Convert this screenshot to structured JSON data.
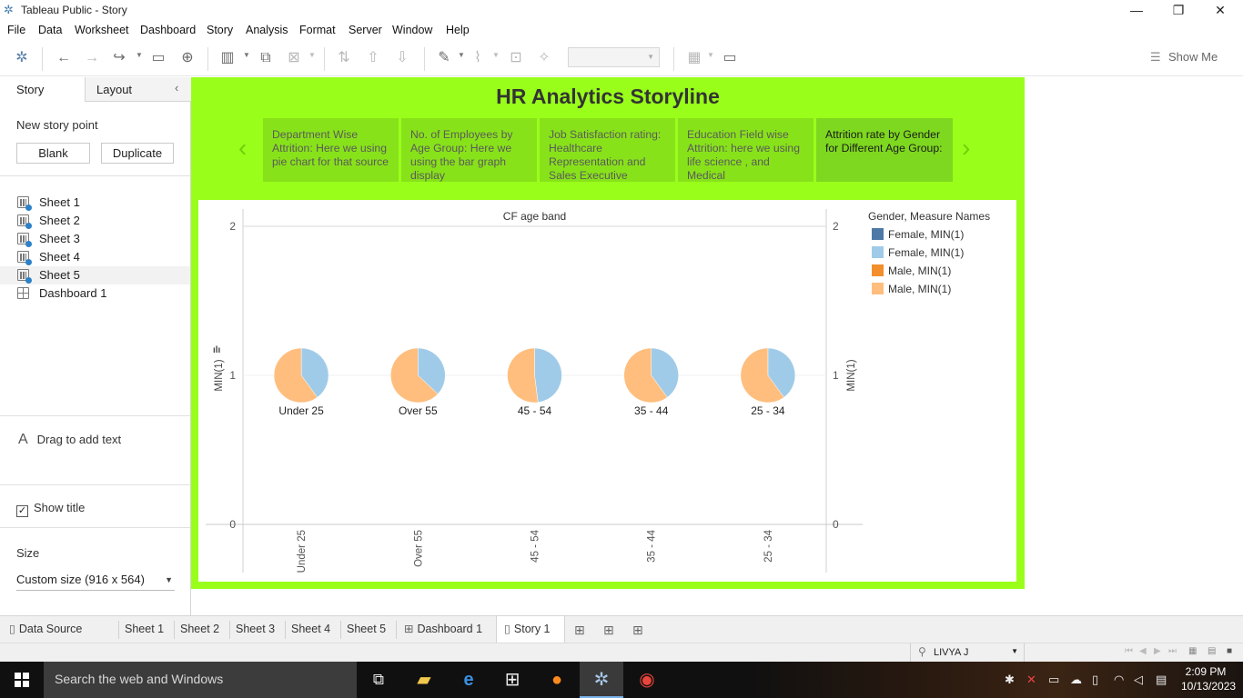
{
  "window": {
    "title": "Tableau Public - Story",
    "minimize": "—",
    "restore": "❐",
    "close": "✕"
  },
  "menu": [
    "File",
    "Data",
    "Worksheet",
    "Dashboard",
    "Story",
    "Analysis",
    "Format",
    "Server",
    "Window",
    "Help"
  ],
  "toolbar": {
    "show_me": "Show Me",
    "icons": [
      "tableau-logo-icon",
      "undo-icon",
      "redo-icon",
      "replay-icon",
      "save-icon",
      "new-data-source-icon",
      "new-worksheet-icon",
      "duplicate-sheet-icon",
      "clear-sheet-icon",
      "swap-icon",
      "sort-ascending-icon",
      "sort-descending-icon",
      "highlight-icon",
      "group-icon",
      "label-icon",
      "fix-axes-icon",
      "fit-icon",
      "presentation-icon"
    ]
  },
  "left_pane": {
    "tabs": [
      "Story",
      "Layout"
    ],
    "collapse": "‹",
    "new_story_point": "New story point",
    "blank_button": "Blank",
    "duplicate_button": "Duplicate",
    "sheets": [
      "Sheet 1",
      "Sheet 2",
      "Sheet 3",
      "Sheet 4",
      "Sheet 5",
      "Dashboard 1"
    ],
    "drag_to_add_text": "Drag to add text",
    "drag_icon": "A",
    "show_title": "Show title",
    "show_title_checked": "✓",
    "size_label": "Size",
    "size_value": "Custom size (916 x 564)"
  },
  "story": {
    "title": "HR Analytics Storyline",
    "background": "#99ff1a",
    "prev_arrow": "‹",
    "next_arrow": "›",
    "points": [
      "Department Wise Attrition: Here we using pie chart for that source",
      "No. of Employees by Age Group: Here we using the bar graph display",
      "Job Satisfaction rating: Healthcare Representation and Sales Executive",
      "Education Field wise Attrition: here we using life science , and Medical",
      "Attrition rate by Gender for Different Age Group:"
    ]
  },
  "chart_data": {
    "type": "pie",
    "title": "CF age band",
    "ylabel": "MIN(1)",
    "ylabel_right": "MIN(1)",
    "ylim": [
      0,
      2
    ],
    "y_ticks": [
      "2",
      "1",
      "0"
    ],
    "legend_title": "Gender, Measure Names",
    "legend_placement": "right",
    "legend": [
      {
        "name": "Female, MIN(1)",
        "color": "#4e79a7"
      },
      {
        "name": "Female, MIN(1)",
        "color": "#a0cbe8"
      },
      {
        "name": "Male, MIN(1)",
        "color": "#f28e2b"
      },
      {
        "name": "Male, MIN(1)",
        "color": "#ffbe7d"
      }
    ],
    "categories": [
      "Under 25",
      "Over 55",
      "45 - 54",
      "35 - 44",
      "25 - 34"
    ],
    "y": 1,
    "series": [
      {
        "name": "Female, MIN(1)",
        "color": "#a0cbe8",
        "values": [
          0.4,
          0.37,
          0.48,
          0.4,
          0.4
        ]
      },
      {
        "name": "Male, MIN(1)",
        "color": "#ffbe7d",
        "values": [
          0.6,
          0.63,
          0.52,
          0.6,
          0.6
        ]
      }
    ]
  },
  "sheet_tabs": {
    "data_source": "Data Source",
    "tabs": [
      "Sheet 1",
      "Sheet 2",
      "Sheet 3",
      "Sheet 4",
      "Sheet 5",
      "Dashboard 1",
      "Story 1"
    ],
    "active": "Story 1"
  },
  "status": {
    "user": "LIVYA J"
  },
  "taskbar": {
    "search_placeholder": "Search the web and Windows",
    "time": "2:09 PM",
    "date": "10/13/2023"
  }
}
